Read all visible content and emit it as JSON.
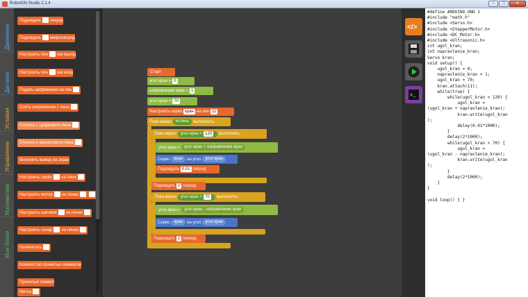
{
  "window": {
    "title": "RobotON Studio 2.1.4",
    "min": "–",
    "max": "□",
    "close": "✕"
  },
  "categories": [
    {
      "label": "Движение",
      "color": "#4da6ff"
    },
    {
      "label": "Датчики",
      "color": "#4da6ff"
    },
    {
      "label": "Условия",
      "color": "#e8a33a"
    },
    {
      "label": "Управление",
      "color": "#e8a33a"
    },
    {
      "label": "Математика",
      "color": "#59b55b"
    },
    {
      "label": "Мои блоки",
      "color": "#59b55b"
    }
  ],
  "palette": [
    {
      "text": "Подождать",
      "suffix": "секунд",
      "slot": true
    },
    {
      "text": "Подождать",
      "suffix": "микросекунд",
      "slot": true
    },
    {
      "text": "Настроить пин",
      "suffix": "как выход",
      "slot": true
    },
    {
      "text": "Настроить пин",
      "suffix": "как вход",
      "slot": true
    },
    {
      "text": "Подать напряжение на пин",
      "suffix": "",
      "slot": true
    },
    {
      "text": "Снять напряжение с пина",
      "suffix": "",
      "slot": true
    },
    {
      "text": "Считать с цифрового пина",
      "suffix": "",
      "slot": true
    },
    {
      "text": "Считать с аналогового пина",
      "suffix": "",
      "slot": true
    },
    {
      "text": "Включить вывод на экран",
      "suffix": "",
      "slot": false
    },
    {
      "text": "Настроить серво",
      "suffix": "на пине",
      "slot": true
    },
    {
      "text": "Настроить мотор",
      "suffix": "на пинах",
      "slot": true
    },
    {
      "text": "Настроить шаговик",
      "suffix": "на пинах",
      "slot": true
    },
    {
      "text": "Настроить сонар",
      "suffix": "на пинах",
      "slot": true
    },
    {
      "text": "Напечатать",
      "suffix": "",
      "slot": true
    },
    {
      "text": "Количество принятых символов",
      "suffix": "",
      "slot": false
    },
    {
      "text": "Принятый символ",
      "suffix": "",
      "slot": false
    },
    {
      "text": "Метка",
      "suffix": "",
      "slot": true
    }
  ],
  "workspace": {
    "start": "Старт",
    "var1": {
      "name": "угол кран",
      "eq": "=",
      "val": "0"
    },
    "var2": {
      "name": "направление кран",
      "eq": "=",
      "val": "1"
    },
    "var3": {
      "name": "угол кран",
      "eq": "=",
      "val": "70"
    },
    "servo_setup": {
      "text": "Настроить серво",
      "name": "кран",
      "pin_label": "на пин",
      "pin": "11"
    },
    "loop": {
      "text": "Пока верно",
      "cond": "истина",
      "suffix": "выполнять:"
    },
    "loop1": {
      "text": "Пока верно",
      "var": "угол кран",
      "op": "<",
      "val": "120",
      "suffix": "выполнять:"
    },
    "assign1": {
      "name": "угол кран",
      "eq": "=",
      "var": "угол кран",
      "op": "+",
      "var2": "направление кран"
    },
    "servo1": {
      "text": "Серво",
      "name": "кран",
      "mid": "на угол",
      "var": "угол кран"
    },
    "wait1": {
      "text": "Подождать",
      "val": "0.01",
      "suffix": "секунд"
    },
    "wait2": {
      "text": "Подождать",
      "val": "2",
      "suffix": "секунд"
    },
    "loop2": {
      "text": "Пока верно",
      "var": "угол кран",
      "op": ">",
      "val": "70",
      "suffix": "выполнять:"
    },
    "assign2": {
      "name": "угол кран",
      "eq": "=",
      "var": "угол кран",
      "op": "-",
      "var2": "направление кран"
    },
    "servo2": {
      "text": "Серво",
      "name": "кран",
      "mid": "на угол",
      "var": "угол кран"
    },
    "wait3": {
      "text": "Подождать",
      "val": "2",
      "suffix": "секунд"
    }
  },
  "toolbar": [
    {
      "name": "code-view",
      "glyph": "</>"
    },
    {
      "name": "save",
      "glyph": "💾"
    },
    {
      "name": "run",
      "glyph": "▶"
    },
    {
      "name": "terminal",
      "glyph": ">_"
    }
  ],
  "code": "#define ARDUINO_UNO 1\n#include \"math.h\"\n#include <Servo.h>\n#include <StepperMotor.h>\n#include <DC_Motor.h>\n#include <Ultrasonic.h>\nint ugol_kran;\nint napravlenie_kran;\nServo kran;\nvoid setup() {\n    ugol_kran = 0;\n    napravlenie_kran = 1;\n    ugol_kran = 70;\n    kran.attach(11);\n    while(true) {\n        while(ugol_kran < 120) {\n            ugol_kran =\n(ugol_kran + napravlenie_kran);\n            kran.write(ugol_kran\n);\n            delay(0.01*1000);\n        }\n        delay(2*1000);\n        while(ugol_kran > 70) {\n            ugol_kran =\n(ugol_kran - napravlenie_kran);\n            kran.write(ugol_kran\n);\n        }\n        delay(2*1000);\n    }\n}\n\nvoid loop() { }"
}
